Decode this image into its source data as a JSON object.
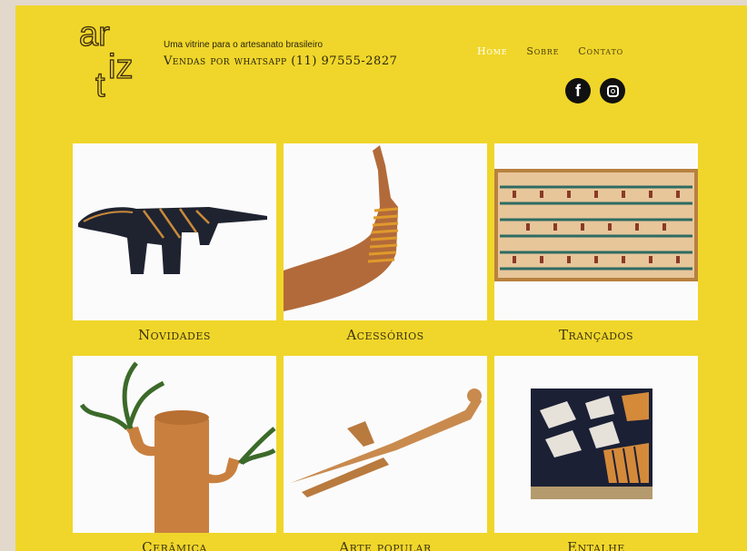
{
  "header": {
    "logo": {
      "letters": [
        "ar",
        "t",
        "iz"
      ]
    },
    "tagline": "Uma vitrine para o artesanato brasileiro",
    "phone": "Vendas por whatsapp (11) 97555-2827"
  },
  "nav": {
    "items": [
      "Home",
      "Sobre",
      "Contato"
    ],
    "active": "Home"
  },
  "social": {
    "facebook_icon": "f"
  },
  "gallery": [
    {
      "label": "Novidades"
    },
    {
      "label": "Acessórios"
    },
    {
      "label": "Trançados"
    },
    {
      "label": "Cerâmica"
    },
    {
      "label": "Arte popular"
    },
    {
      "label": "Entalhe"
    }
  ],
  "colors": {
    "background": "#f0d62a",
    "frame": "#e3d8cc"
  }
}
